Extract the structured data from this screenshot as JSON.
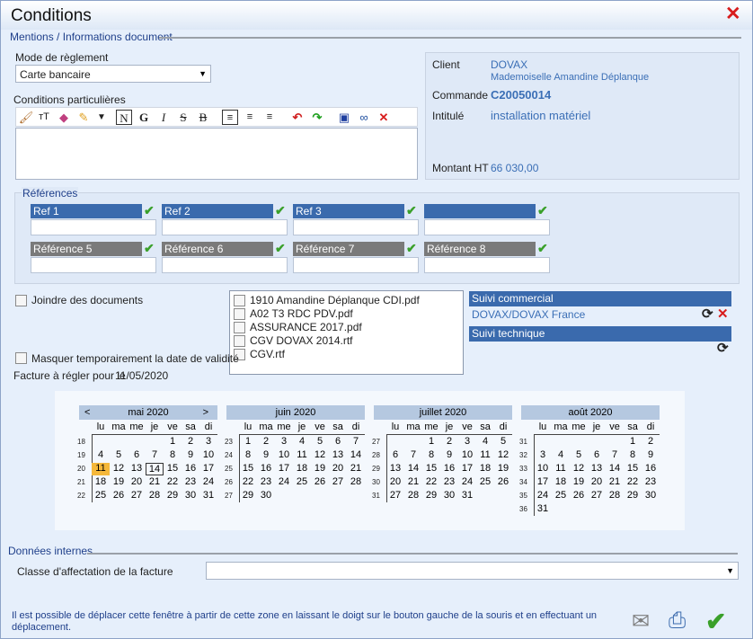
{
  "window": {
    "title": "Conditions",
    "close_icon": "close-red-x-icon"
  },
  "sections": {
    "mentions": "Mentions / Informations document",
    "references": "Références",
    "internal": "Données internes"
  },
  "payment": {
    "label": "Mode de règlement",
    "value": "Carte bancaire"
  },
  "conditions": {
    "label": "Conditions particulières",
    "text": ""
  },
  "editor_toolbar": {
    "icons": [
      "brush-icon",
      "text-size-icon",
      "palette-icon",
      "highlighter-icon",
      "dropdown-arrow-icon",
      "normal-style-icon",
      "bold-icon",
      "italic-icon",
      "strikethrough-icon",
      "double-strike-icon",
      "align-left-icon",
      "align-center-icon",
      "align-right-icon",
      "undo-icon",
      "redo-icon",
      "save-icon",
      "binoculars-icon",
      "delete-icon"
    ],
    "glyphs": {
      "normal": "N",
      "bold": "G",
      "italic": "I",
      "strike": "S",
      "dstrike": "B"
    }
  },
  "client": {
    "client_label": "Client",
    "client_value": "DOVAX",
    "client_contact": "Mademoiselle Amandine Déplanque",
    "order_label": "Commande",
    "order_value": "C20050014",
    "title_label": "Intitulé",
    "title_value": "installation matériel",
    "amount_label": "Montant HT",
    "amount_value": "66 030,00"
  },
  "references": {
    "row1": [
      {
        "label": "Ref 1",
        "value": ""
      },
      {
        "label": "Ref 2",
        "value": ""
      },
      {
        "label": "Ref 3",
        "value": ""
      },
      {
        "label": "",
        "value": ""
      }
    ],
    "row2": [
      {
        "label": "Référence 5",
        "value": ""
      },
      {
        "label": "Référence 6",
        "value": ""
      },
      {
        "label": "Référence 7",
        "value": ""
      },
      {
        "label": "Référence 8",
        "value": ""
      }
    ],
    "check_icon": "green-check-icon"
  },
  "attach": {
    "label": "Joindre des documents",
    "checked": false
  },
  "documents": [
    "1910 Amandine Déplanque CDI.pdf",
    "A02 T3 RDC PDV.pdf",
    "ASSURANCE 2017.pdf",
    "CGV DOVAX 2014.rtf",
    "CGV.rtf"
  ],
  "follow": {
    "commercial_title": "Suivi commercial",
    "commercial_value": "DOVAX/DOVAX France",
    "technical_title": "Suivi technique",
    "refresh_icon": "refresh-icon",
    "delete_icon": "delete-icon"
  },
  "validity": {
    "label": "Masquer temporairement la date de validité",
    "checked": false
  },
  "due": {
    "label": "Facture à régler pour le",
    "date": "11/05/2020"
  },
  "calendar": {
    "weekdays": [
      "lu",
      "ma",
      "me",
      "je",
      "ve",
      "sa",
      "di"
    ],
    "prev": "<",
    "next": ">",
    "months": [
      {
        "name": "mai 2020",
        "weeks": [
          "18",
          "19",
          "20",
          "21",
          "22"
        ],
        "start": 4,
        "days": 31,
        "today": 11,
        "selected": 14
      },
      {
        "name": "juin 2020",
        "weeks": [
          "23",
          "24",
          "25",
          "26",
          "27"
        ],
        "start": 0,
        "days": 30
      },
      {
        "name": "juillet 2020",
        "weeks": [
          "27",
          "28",
          "29",
          "30",
          "31"
        ],
        "start": 2,
        "days": 31
      },
      {
        "name": "août 2020",
        "weeks": [
          "31",
          "32",
          "33",
          "34",
          "35",
          "36"
        ],
        "start": 5,
        "days": 31
      }
    ]
  },
  "internal": {
    "label": "Classe d'affectation de la facture",
    "value": ""
  },
  "footer": {
    "note": "Il est possible de déplacer cette fenêtre à partir de cette zone en laissant le doigt sur le bouton gauche de la souris et en effectuant un déplacement.",
    "icons": [
      "send-mail-icon",
      "printer-icon",
      "validate-check-icon"
    ]
  },
  "colors": {
    "accent": "#3a6aad",
    "reference_grey": "#7a7a7a",
    "today": "#f5b83a",
    "close": "#d81c1c",
    "check": "#3aa02a"
  }
}
